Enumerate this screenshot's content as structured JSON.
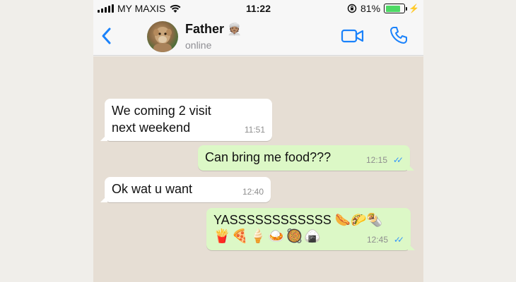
{
  "status_bar": {
    "carrier": "MY MAXIS",
    "time": "11:22",
    "battery": "81%",
    "battery_level": 0.81,
    "icons": [
      "signal-icon",
      "wifi-icon",
      "rotation-lock-icon",
      "battery-icon",
      "charging-icon"
    ]
  },
  "header": {
    "back_icon": "chevron-left-icon",
    "contact_name": "Father",
    "name_emoji": "👳🏽",
    "status": "online",
    "actions": [
      "video-call-icon",
      "phone-call-icon"
    ],
    "accent_color": "#1a82fb"
  },
  "messages": [
    {
      "direction": "in",
      "lines": [
        "We coming 2 visit",
        "next weekend"
      ],
      "time": "11:51"
    },
    {
      "direction": "out",
      "lines": [
        "Can bring me food???"
      ],
      "time": "12:15",
      "read": true
    },
    {
      "direction": "in",
      "lines": [
        "Ok wat u want"
      ],
      "time": "12:40"
    },
    {
      "direction": "out",
      "lines": [
        "YASSSSSSSSSSSS 🌭🌮🌯",
        "🍟🍕🍦🍛🥘🍙"
      ],
      "time": "12:45",
      "read": true
    }
  ],
  "colors": {
    "incoming_bubble": "#ffffff",
    "outgoing_bubble": "#dcf8c6",
    "read_ticks": "#3497f9",
    "chat_background": "#e6ded4"
  }
}
